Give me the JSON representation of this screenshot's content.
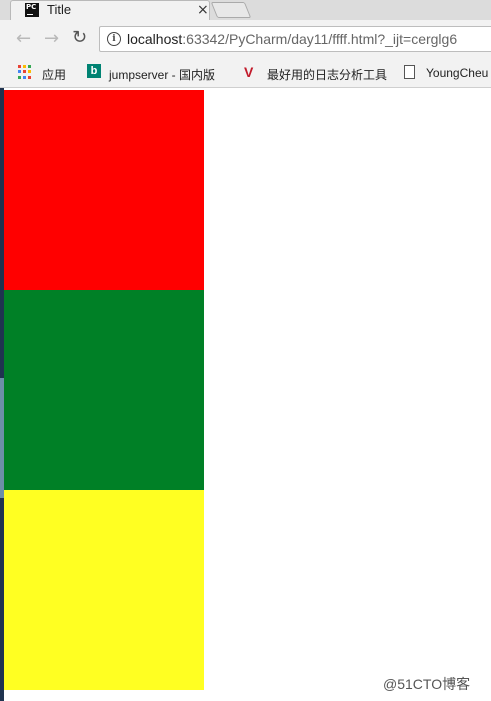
{
  "browser": {
    "tab": {
      "title": "Title",
      "favicon_text": "PC",
      "close_glyph": "×"
    },
    "toolbar": {
      "back_glyph": "←",
      "forward_glyph": "→",
      "reload_glyph": "↻",
      "address_host": "localhost",
      "address_rest": ":63342/PyCharm/day11/ffff.html?_ijt=cerglg6"
    },
    "bookmarks": [
      {
        "label": "应用",
        "icon": "apps-grid-icon"
      },
      {
        "label": "jumpserver - 国内版",
        "icon": "bing-icon"
      },
      {
        "label": "最好用的日志分析工具",
        "icon": "visualization-icon"
      },
      {
        "label": "YoungCheu",
        "icon": "document-icon"
      }
    ]
  },
  "page": {
    "boxes": [
      {
        "name": "red",
        "color": "#ff0000"
      },
      {
        "name": "green",
        "color": "#008026"
      },
      {
        "name": "yellow",
        "color": "#ffff22"
      }
    ]
  },
  "watermark": "@51CTO博客"
}
